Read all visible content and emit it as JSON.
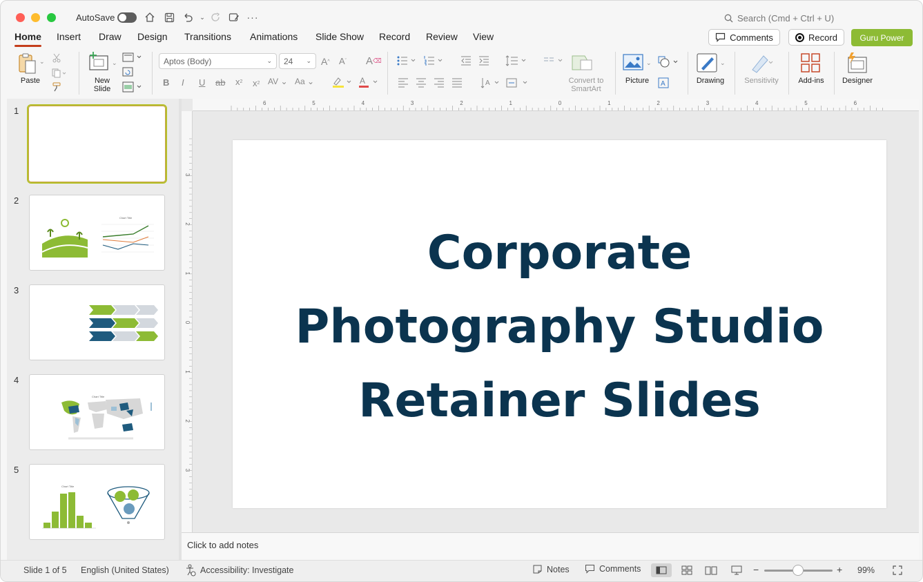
{
  "titlebar": {
    "autosave_label": "AutoSave",
    "autosave_on": false,
    "search_placeholder": "Search (Cmd + Ctrl + U)"
  },
  "tabs": [
    "Home",
    "Insert",
    "Draw",
    "Design",
    "Transitions",
    "Animations",
    "Slide Show",
    "Record",
    "Review",
    "View"
  ],
  "active_tab": "Home",
  "actions": {
    "comments_label": "Comments",
    "record_label": "Record",
    "guru_label": "Guru Power",
    "guru_color": "#8dbb35"
  },
  "ribbon": {
    "paste": "Paste",
    "new_slide_line1": "New",
    "new_slide_line2": "Slide",
    "font_name": "Aptos (Body)",
    "font_size": "24",
    "convert_line1": "Convert to",
    "convert_line2": "SmartArt",
    "picture": "Picture",
    "drawing": "Drawing",
    "sensitivity": "Sensitivity",
    "addins": "Add-ins",
    "designer": "Designer"
  },
  "thumbnails": [
    {
      "num": "1",
      "selected": true
    },
    {
      "num": "2"
    },
    {
      "num": "3"
    },
    {
      "num": "4"
    },
    {
      "num": "5"
    }
  ],
  "slide": {
    "title_lines": [
      "Corporate",
      "Photography Studio",
      "Retainer Slides"
    ],
    "title_color": "#0b344f"
  },
  "notes_placeholder": "Click to add notes",
  "status": {
    "slide_info": "Slide 1 of 5",
    "language": "English (United States)",
    "accessibility": "Accessibility: Investigate",
    "notes": "Notes",
    "comments": "Comments",
    "zoom": "99%"
  },
  "ruler": {
    "h_labels": [
      "6",
      "5",
      "4",
      "3",
      "2",
      "1",
      "0",
      "1",
      "2",
      "3",
      "4",
      "5",
      "6"
    ],
    "v_labels": [
      "3",
      "2",
      "1",
      "0",
      "1",
      "2",
      "3"
    ]
  },
  "colors": {
    "accent_green": "#8dbb35",
    "dark_blue": "#1f5b7e",
    "tab_underline": "#c43e1c"
  }
}
